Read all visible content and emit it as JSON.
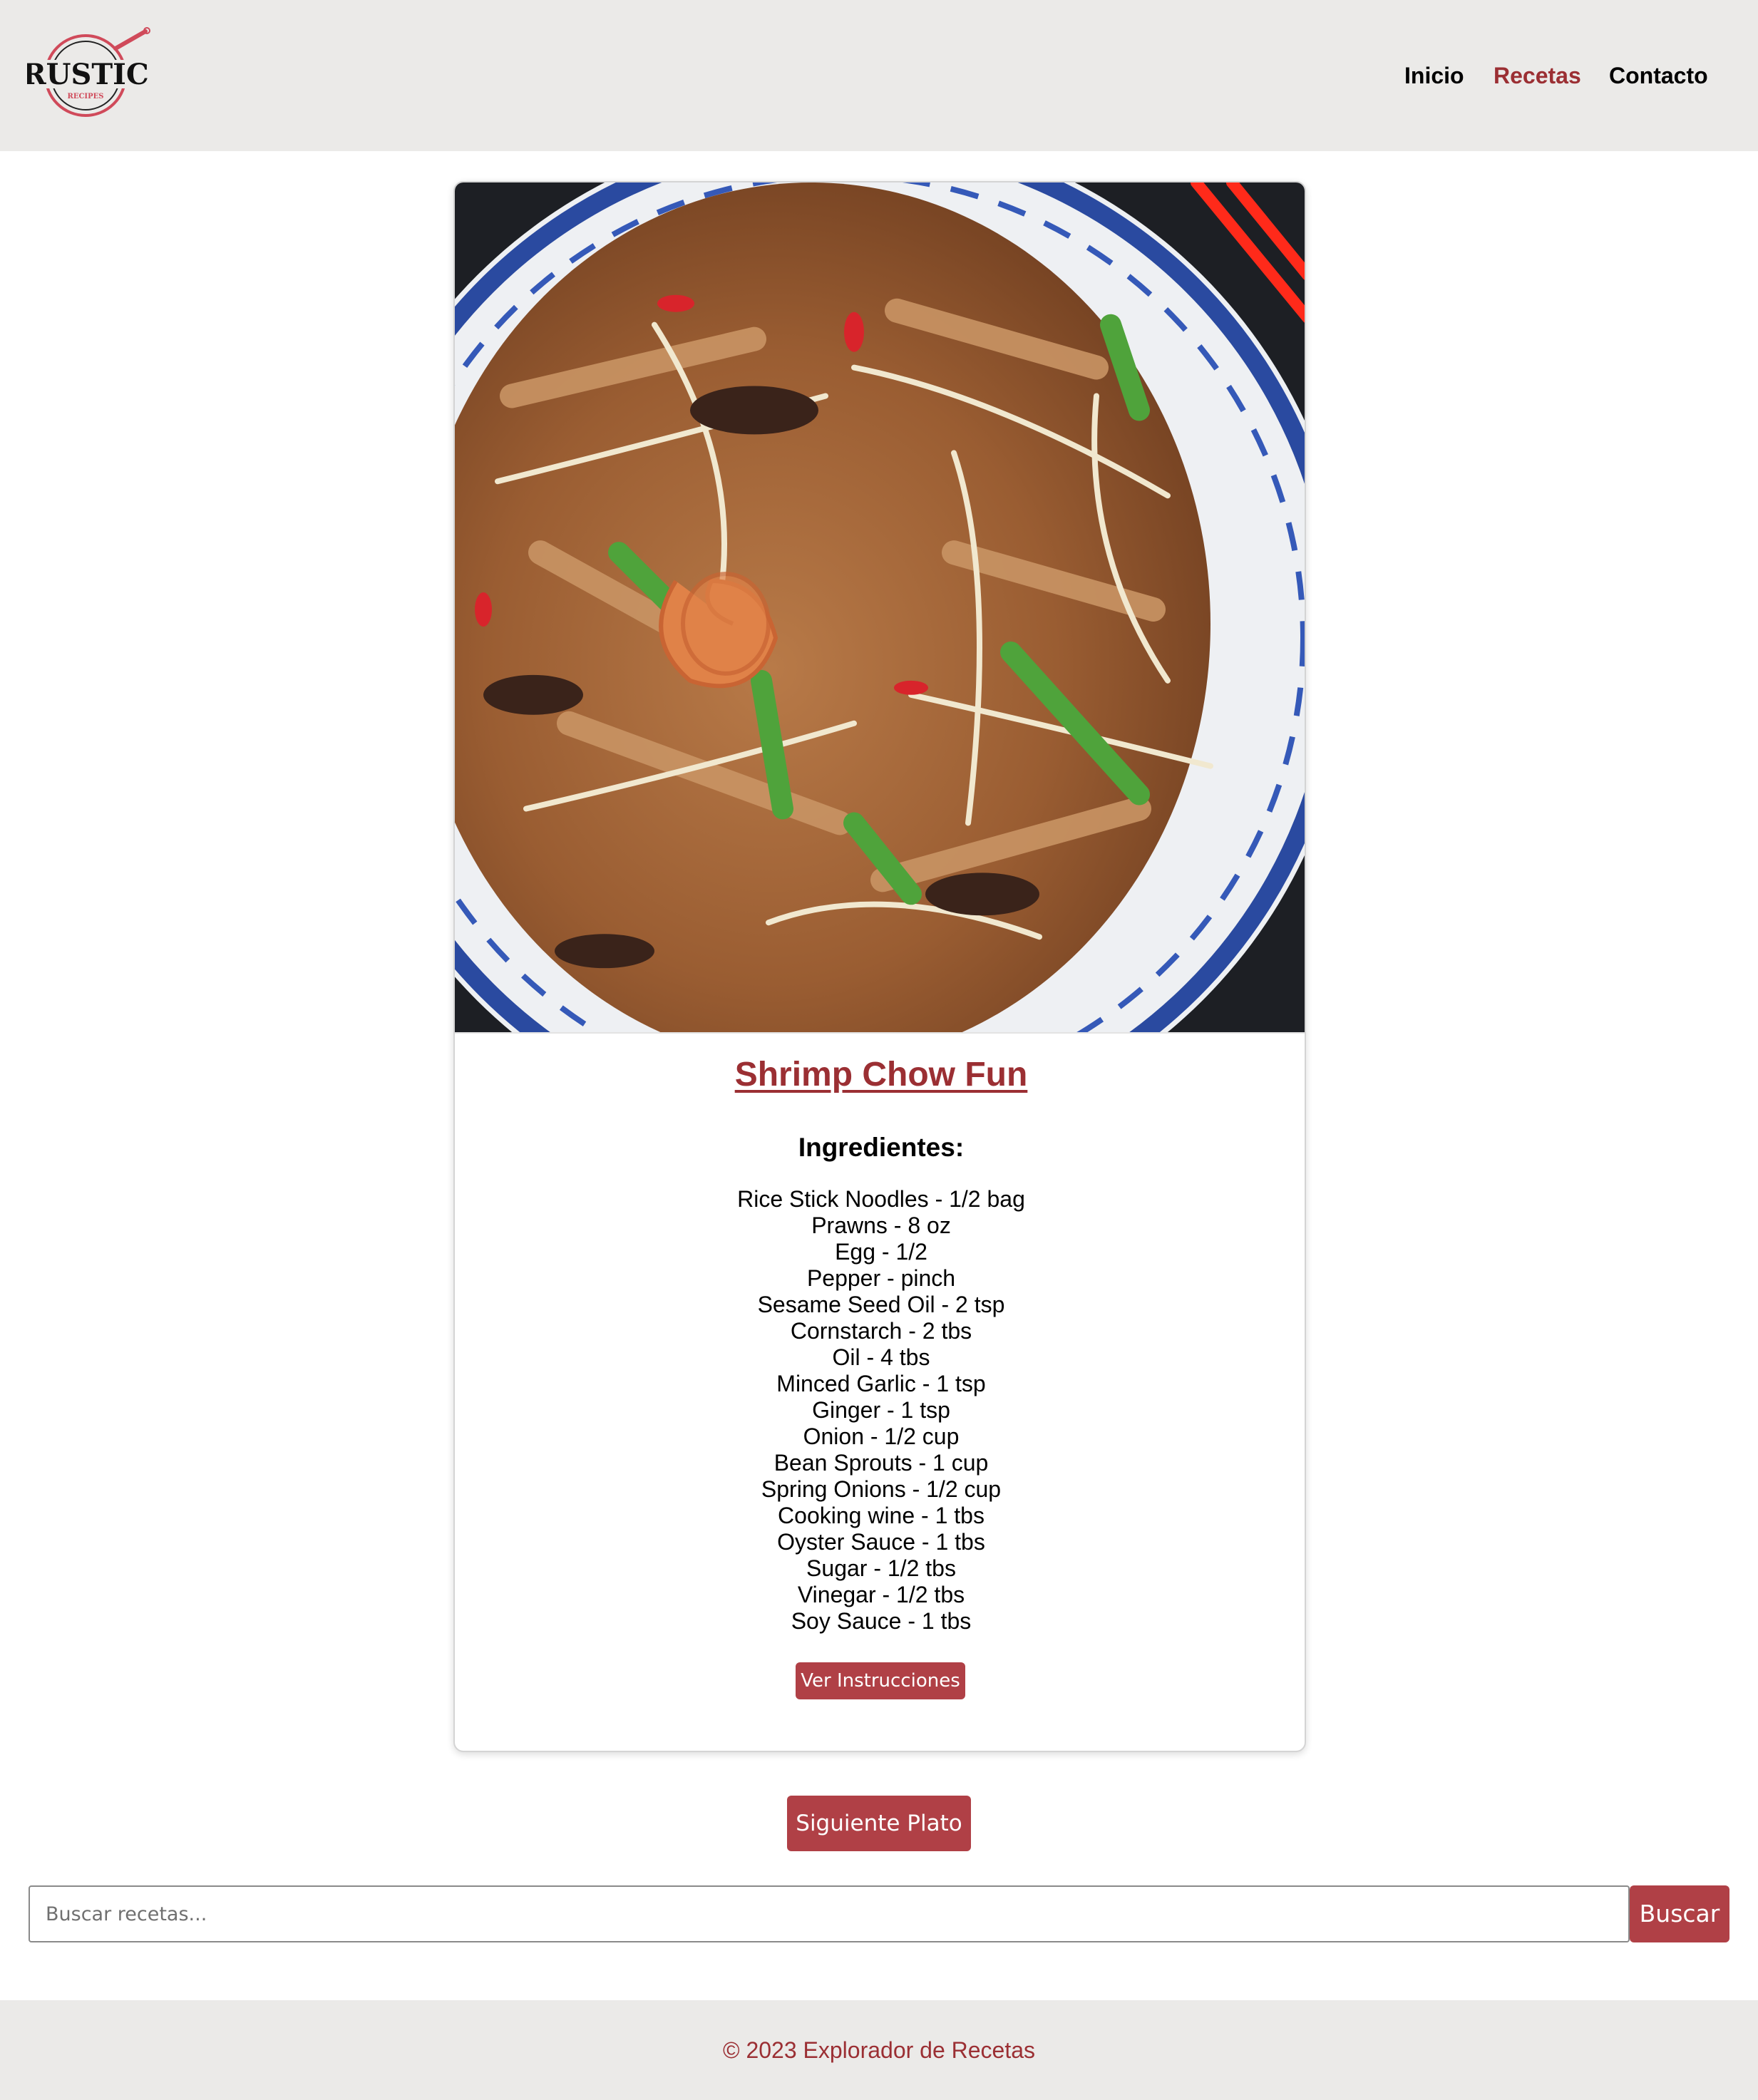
{
  "header": {
    "logo": {
      "text": "RUSTIC",
      "subtext": "RECIPES"
    },
    "nav": [
      {
        "label": "Inicio",
        "active": false
      },
      {
        "label": "Recetas",
        "active": true
      },
      {
        "label": "Contacto",
        "active": false
      }
    ]
  },
  "recipe": {
    "title": "Shrimp Chow Fun",
    "ingredients_heading": "Ingredientes:",
    "ingredients": [
      "Rice Stick Noodles - 1/2 bag",
      "Prawns - 8 oz",
      "Egg - 1/2",
      "Pepper - pinch",
      "Sesame Seed Oil - 2 tsp",
      "Cornstarch - 2 tbs",
      "Oil - 4 tbs",
      "Minced Garlic - 1 tsp",
      "Ginger - 1 tsp",
      "Onion - 1/2 cup",
      "Bean Sprouts - 1 cup",
      "Spring Onions - 1/2 cup",
      "Cooking wine - 1 tbs",
      "Oyster Sauce - 1 tbs",
      "Sugar - 1/2 tbs",
      "Vinegar - 1/2 tbs",
      "Soy Sauce - 1 tbs"
    ],
    "instructions_button": "Ver Instrucciones"
  },
  "next_button": "Siguiente Plato",
  "search": {
    "placeholder": "Buscar recetas...",
    "value": "",
    "button": "Buscar"
  },
  "footer": {
    "text": "© 2023 Explorador de Recetas"
  },
  "colors": {
    "accent": "#9b2f33",
    "button": "#b04046",
    "header_bg": "#ebeae8"
  }
}
